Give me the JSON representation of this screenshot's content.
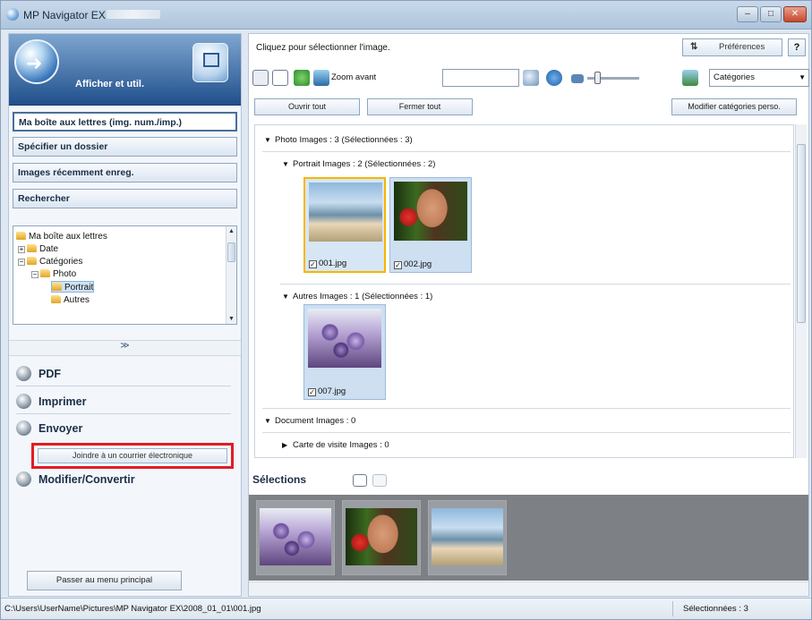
{
  "window": {
    "title": "MP Navigator EX",
    "minimize": "–",
    "maximize": "□",
    "close": "✕"
  },
  "left": {
    "header_label": "Afficher et util.",
    "nav": [
      {
        "label": "Ma boîte aux lettres (img. num./imp.)",
        "active": true
      },
      {
        "label": "Spécifier un dossier"
      },
      {
        "label": "Images récemment enreg."
      },
      {
        "label": "Rechercher"
      }
    ],
    "tree": [
      {
        "label": "Ma boîte aux lettres"
      },
      {
        "label": "Date"
      },
      {
        "label": "Catégories"
      },
      {
        "label": "Photo"
      },
      {
        "label": "Portrait"
      },
      {
        "label": "Autres"
      }
    ],
    "collapse_arrow": "≫",
    "actions": {
      "pdf": "PDF",
      "print": "Imprimer",
      "send": "Envoyer",
      "attach_email": "Joindre à un courrier électronique",
      "edit_convert": "Modifier/Convertir"
    },
    "back_button": "Passer au menu principal"
  },
  "right": {
    "hint": "Cliquez pour sélectionner l'image.",
    "preferences": "Préférences",
    "help": "?",
    "zoom_label": "Zoom avant",
    "category_select": "Catégories",
    "open_all": "Ouvrir tout",
    "close_all": "Fermer tout",
    "edit_categories": "Modifier catégories perso.",
    "groups": {
      "photo": "Photo    Images : 3    (Sélectionnées : 3)",
      "portrait": "Portrait    Images : 2    (Sélectionnées : 2)",
      "autres": "Autres    Images : 1    (Sélectionnées : 1)",
      "document": "Document    Images : 0",
      "carte": "Carte de visite    Images : 0"
    },
    "thumbs": {
      "t1": "001.jpg",
      "t2": "002.jpg",
      "t3": "007.jpg"
    },
    "selections_title": "Sélections"
  },
  "status": {
    "path": "C:\\Users\\UserName\\Pictures\\MP Navigator EX\\2008_01_01\\001.jpg",
    "selected": "Sélectionnées : 3"
  },
  "colors": {
    "accent_red": "#e21b24",
    "selected_border": "#f6b700",
    "header_blue": "#1f4f8c"
  }
}
